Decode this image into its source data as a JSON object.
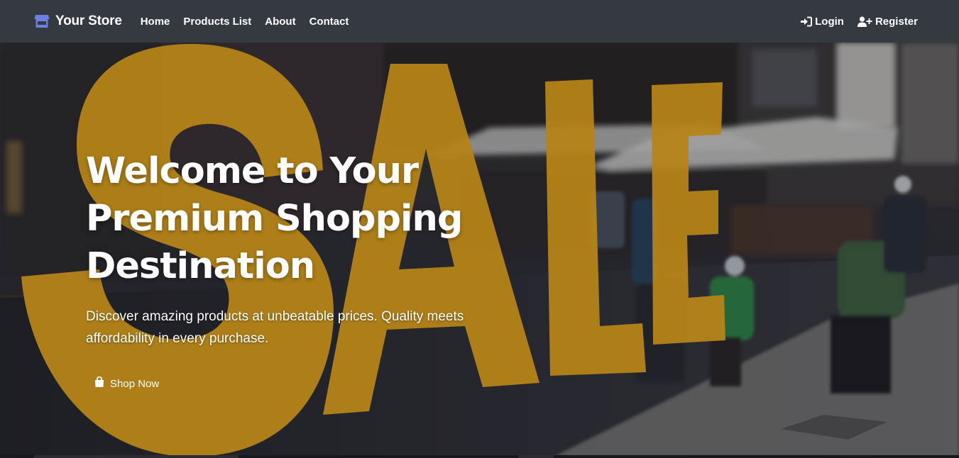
{
  "navbar": {
    "brand": "Your Store",
    "brand_icon": "store-icon",
    "links": [
      "Home",
      "Products List",
      "About",
      "Contact"
    ],
    "login": "Login",
    "login_icon": "sign-in-icon",
    "register": "Register",
    "register_icon": "user-plus-icon"
  },
  "hero": {
    "title_lines": [
      "Welcome to Your",
      "Premium Shopping",
      "Destination"
    ],
    "subtitle": "Discover amazing products at unbeatable prices. Quality meets affordability in every purchase.",
    "cta": "Shop Now",
    "cta_icon": "shopping-bag-icon",
    "background_text": "SALE",
    "colors": {
      "accent_yellow": "#f7b21a",
      "navbar": "#343a40",
      "brand_icon": "#6f7ee6"
    }
  }
}
